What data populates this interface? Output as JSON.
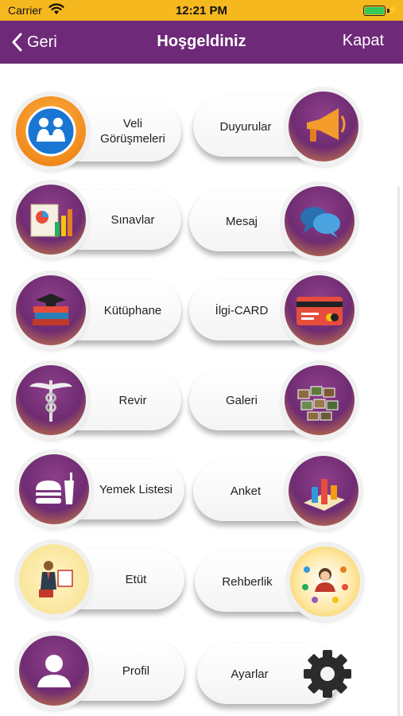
{
  "status_bar": {
    "carrier": "Carrier",
    "time": "12:21 PM",
    "battery_level": 1.0
  },
  "navbar": {
    "back_label": "Geri",
    "title": "Hoşgeldiniz",
    "close_label": "Kapat"
  },
  "menu": {
    "veli": {
      "label": "Veli Görüşmeleri",
      "icon": "parent-meeting-icon"
    },
    "duyurular": {
      "label": "Duyurular",
      "icon": "megaphone-icon"
    },
    "sinavlar": {
      "label": "Sınavlar",
      "icon": "exam-charts-icon"
    },
    "mesaj": {
      "label": "Mesaj",
      "icon": "chat-bubbles-icon"
    },
    "kutuphane": {
      "label": "Kütüphane",
      "icon": "books-icon"
    },
    "ilgicard": {
      "label": "İlgi-CARD",
      "icon": "credit-card-icon"
    },
    "revir": {
      "label": "Revir",
      "icon": "caduceus-icon"
    },
    "galeri": {
      "label": "Galeri",
      "icon": "photo-gallery-icon"
    },
    "yemek": {
      "label": "Yemek Listesi",
      "icon": "burger-meal-icon"
    },
    "anket": {
      "label": "Anket",
      "icon": "survey-chart-icon"
    },
    "etut": {
      "label": "Etüt",
      "icon": "teacher-board-icon"
    },
    "rehberlik": {
      "label": "Rehberlik",
      "icon": "counselor-icon"
    },
    "profil": {
      "label": "Profil",
      "icon": "user-icon"
    },
    "ayarlar": {
      "label": "Ayarlar",
      "icon": "gear-icon"
    }
  },
  "colors": {
    "status_bar": "#f6b81f",
    "navbar": "#6e2a78",
    "accent_purple": "#7a3478",
    "accent_orange": "#e08a2a"
  }
}
